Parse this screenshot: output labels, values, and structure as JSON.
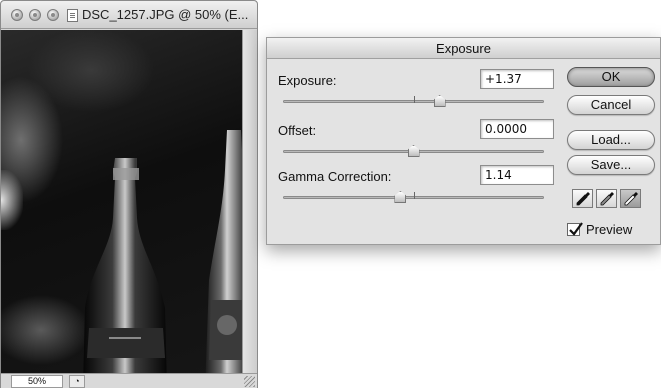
{
  "document": {
    "title": "DSC_1257.JPG @ 50% (E...",
    "zoom": "50%"
  },
  "dialog": {
    "title": "Exposure",
    "exposure": {
      "label": "Exposure:",
      "value": "+1.37",
      "slider_level": 0.6
    },
    "offset": {
      "label": "Offset:",
      "value": "0.0000",
      "slider_level": 0.5
    },
    "gamma": {
      "label": "Gamma Correction:",
      "value": "1.14",
      "slider_level": 0.45
    },
    "buttons": {
      "ok": "OK",
      "cancel": "Cancel",
      "load": "Load...",
      "save": "Save..."
    },
    "eyedroppers": [
      "black-point-eyedropper-icon",
      "gray-point-eyedropper-icon",
      "white-point-eyedropper-icon"
    ],
    "preview": {
      "label": "Preview",
      "checked": true
    }
  }
}
